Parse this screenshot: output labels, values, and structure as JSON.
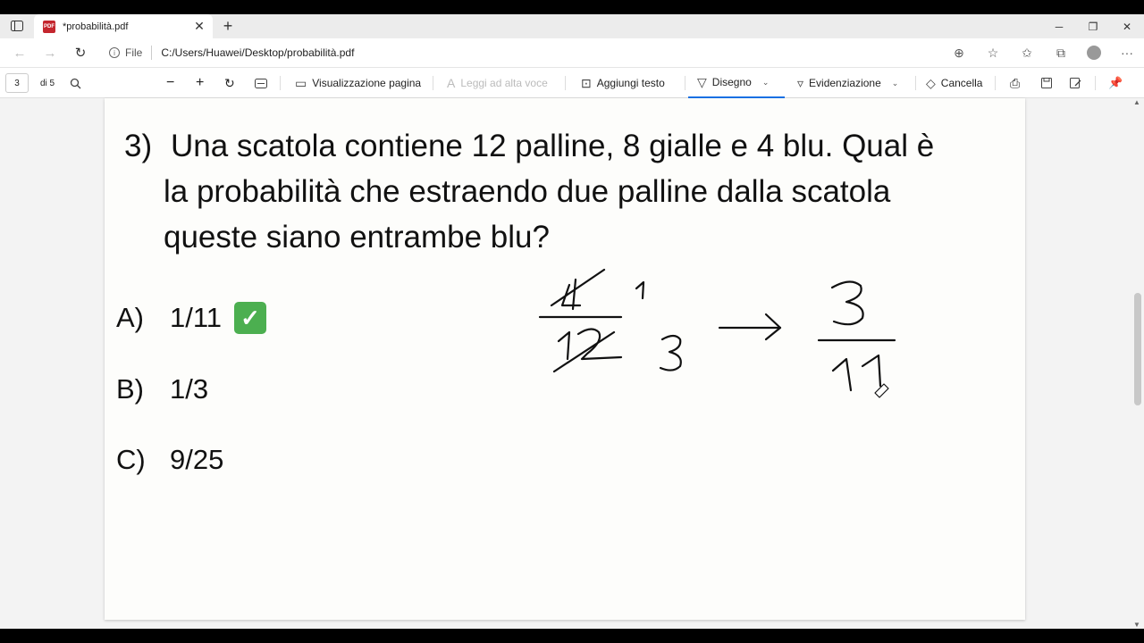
{
  "browser": {
    "tab_title": "*probabilità.pdf",
    "pdf_badge": "PDF",
    "new_tab": "+",
    "tab_close": "✕",
    "file_label": "File",
    "url": "C:/Users/Huawei/Desktop/probabilità.pdf"
  },
  "pdf_toolbar": {
    "page_number": "3",
    "page_total": "di 5",
    "view_label": "Visualizzazione pagina",
    "read_aloud": "Leggi ad alta voce",
    "add_text": "Aggiungi testo",
    "draw": "Disegno",
    "highlight": "Evidenziazione",
    "erase": "Cancella"
  },
  "document": {
    "question_number": "3)",
    "question_lines": [
      "Una scatola contiene 12 palline, 8 gialle e 4 blu. Qual è",
      "la probabilità che estraendo due palline dalla scatola",
      "queste siano entrambe blu?"
    ],
    "answers": [
      {
        "letter": "A)",
        "value": "1/11",
        "correct": true
      },
      {
        "letter": "B)",
        "value": "1/3",
        "correct": false
      },
      {
        "letter": "C)",
        "value": "9/25",
        "correct": false
      }
    ],
    "check_mark": "✓"
  },
  "colors": {
    "accent": "#1a73e8",
    "check_green": "#4caf50",
    "page_bg": "#fdfdfb"
  },
  "icons": [
    "tab-actions-icon",
    "pdf-icon",
    "back-icon",
    "forward-icon",
    "refresh-icon",
    "info-icon",
    "zoom-icon",
    "favorite-add-icon",
    "favorites-icon",
    "collections-icon",
    "profile-icon",
    "more-icon",
    "search-icon",
    "zoom-out-icon",
    "zoom-in-icon",
    "rotate-icon",
    "fit-icon",
    "view-icon",
    "read-aloud-icon",
    "add-text-icon",
    "draw-icon",
    "highlight-icon",
    "eraser-icon",
    "print-icon",
    "save-icon",
    "save-as-icon",
    "pin-icon"
  ]
}
